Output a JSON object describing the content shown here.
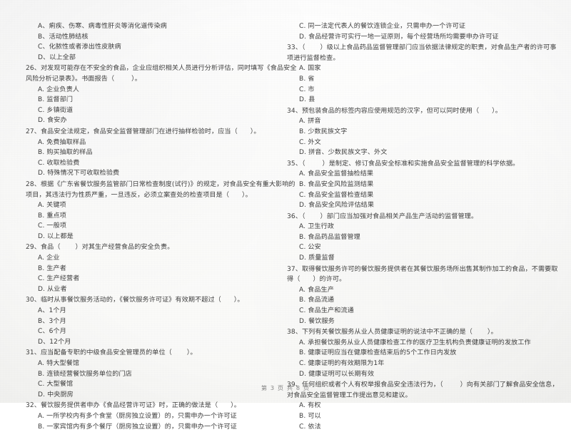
{
  "document": {
    "type": "scanned-exam-paper",
    "language": "zh-CN",
    "page_label": "第 3 页  共 8 页",
    "page_number": "3",
    "total_pages": "8"
  },
  "left_column": {
    "orphan_options": [
      "A、痢疾、伤寒、病毒性肝炎等消化道传染病",
      "B、活动性肺结核",
      "C、化脓性或者渗出性皮肤病",
      "D、以上全部"
    ],
    "questions": [
      {
        "number": "26",
        "stem": "26、对发现可能存在不安全的食品，企业应组织相关人员进行分析评估，同时填写《食品安全",
        "stem_cont": "风险分析记录表》。书面报告（        ）。",
        "options": [
          "A. 企业负责人",
          "B. 监督部门",
          "C. 乡镇街道",
          "D. 食安办"
        ]
      },
      {
        "number": "27",
        "stem": "27、食品安全法规定，食品安全监督管理部门在进行抽样检验时，应当（      ）。",
        "stem_cont": "",
        "options": [
          "A. 免费抽取样品",
          "B. 购买抽取的样品",
          "C. 收取检验费",
          "D. 特殊情况下可收取检验费"
        ]
      },
      {
        "number": "28",
        "stem": "28、根据《广东省餐饮服务监管部门日常检查制度(试行)》的规定，对食品安全有重大影响的",
        "stem_cont": "项目，其违法行为性质严重，一旦违反，必须立案查处的检查项目是（      ）。",
        "options": [
          "A. 关键项",
          "B. 重点项",
          "C. 一般项",
          "D. 以上都是"
        ]
      },
      {
        "number": "29",
        "stem": "29、食品（       ）对其生产经营食品的安全负责。",
        "stem_cont": "",
        "options": [
          "A. 企业",
          "B. 生产者",
          "C. 生产经营者",
          "D. 从业者"
        ]
      },
      {
        "number": "30",
        "stem": "30、临时从事餐饮服务活动的，《餐饮服务许可证》有效期不超过（      ）。",
        "stem_cont": "",
        "options": [
          "A、1个月",
          "B、3个月",
          "C、6个月",
          "D、12个月"
        ]
      },
      {
        "number": "31",
        "stem": "31、应当配备专职的中级食品安全管理员的单位（       ）。",
        "stem_cont": "",
        "options": [
          "A. 特大型餐馆",
          "B. 连锁经营餐饮服务单位的门店",
          "C. 大型餐馆",
          "D. 中央厨房"
        ]
      },
      {
        "number": "32",
        "stem": "32、餐饮服务提供者申办《食品经营许可证》时，正确的做法是（      ）。",
        "stem_cont": "",
        "options": [
          "A. 一所学校内有多个食堂（厨房独立设置）的，只需申办一个许可证",
          "B. 一家宾馆内有多个餐厅（厨房独立设置）的，只需申办一个许可证"
        ]
      }
    ]
  },
  "right_column": {
    "orphan_options": [
      "C. 同一法定代表人的餐饮连锁企业，只需申办一个许可证",
      "D. 食品经营许可实行一地一证原则，每个经营场所均需要申办许可证"
    ],
    "questions": [
      {
        "number": "33",
        "stem": "33、（       ）级以上食品药品监督管理部门应当依据法律规定的职责，对食品生产者的许可事",
        "stem_cont": "项进行监督检查。",
        "options": [
          "A. 国家",
          "B. 省",
          "C. 市",
          "D. 县"
        ]
      },
      {
        "number": "34",
        "stem": "34、预包装食品的标签内容应使用规范的汉字，但可以同时使用（      ）。",
        "stem_cont": "",
        "options": [
          "A. 拼音",
          "B. 少数民族文字",
          "C. 外文",
          "D. 拼音、少数民族文字、外文"
        ]
      },
      {
        "number": "35",
        "stem": "35、（        ）是制定、修订食品安全标准和实施食品安全监督管理的科学依据。",
        "stem_cont": "",
        "options": [
          "A. 食品安全监督抽检结果",
          "B. 食品安全风险监测结果",
          "C. 食品安全监督检查结果",
          "D. 食品安全风险评估结果"
        ]
      },
      {
        "number": "36",
        "stem": "36、（       ）部门应当加强对食品相关产品生产活动的监督管理。",
        "stem_cont": "",
        "options": [
          "A. 卫生行政",
          "B. 食品药品监督管理",
          "C. 公安",
          "D. 质量监督"
        ]
      },
      {
        "number": "37",
        "stem": "37、取得餐饮服务许可的餐饮服务提供者在其餐饮服务场所出售其制作加工的食品，不需要取",
        "stem_cont": "得（      ）的许可。",
        "options": [
          "A. 食品生产",
          "B. 食品流通",
          "C. 食品生产和流通",
          "D. 餐饮服务"
        ]
      },
      {
        "number": "38",
        "stem": "38、下列有关餐饮服务从业人员健康证明的说法中不正确的是（       ）。",
        "stem_cont": "",
        "options": [
          "A. 承担餐饮服务从业人员健康检查工作的医疗卫生机构负责健康证明的发放工作",
          "B. 健康证明应当在健康检查结束后的5个工作日内发放",
          "C. 健康证明的有效期限为1年",
          "D. 健康证明可以长期有效"
        ]
      },
      {
        "number": "39",
        "stem": "39、任何组织或者个人有权举报食品安全违法行为，（        ）向有关部门了解食品安全信息，",
        "stem_cont": "对食品安全监督管理工作提出意见和建议。",
        "options": [
          "A. 有权",
          "B. 可以",
          "C. 依法"
        ]
      }
    ]
  }
}
